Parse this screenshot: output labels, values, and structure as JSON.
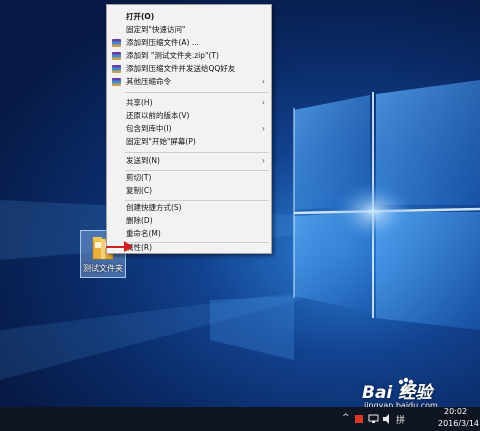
{
  "context_menu": {
    "items": [
      {
        "label": "打开(O)",
        "bold": true
      },
      {
        "label": "固定到\"快速访问\""
      },
      {
        "label": "添加到压缩文件(A) ...",
        "icon": "winrar-icon"
      },
      {
        "label": "添加到 \"测试文件夹.zip\"(T)",
        "icon": "winrar-icon"
      },
      {
        "label": "添加到压缩文件并发送给QQ好友",
        "icon": "winrar-icon"
      },
      {
        "label": "其他压缩命令",
        "icon": "winrar-icon",
        "submenu": true
      },
      {
        "label": "共享(H)",
        "submenu": true
      },
      {
        "label": "还原以前的版本(V)"
      },
      {
        "label": "包含到库中(I)",
        "submenu": true
      },
      {
        "label": "固定到\"开始\"屏幕(P)"
      },
      {
        "label": "发送到(N)",
        "submenu": true
      },
      {
        "label": "剪切(T)"
      },
      {
        "label": "复制(C)"
      },
      {
        "label": "创建快捷方式(S)"
      },
      {
        "label": "删除(D)"
      },
      {
        "label": "重命名(M)"
      },
      {
        "label": "属性(R)"
      }
    ],
    "submenu_arrow": "›"
  },
  "desktop": {
    "folder_label": "测试文件夹"
  },
  "taskbar": {
    "tray_up_arrow": "^",
    "tray_pinyin": "拼",
    "clock_time": "20:02",
    "clock_date": "2016/3/14"
  },
  "watermark": {
    "main": "Bai 经验",
    "sub": "jingyan.baidu.com"
  },
  "colors": {
    "menu_bg": "#f2f2f2",
    "annotation_red": "#d42020",
    "taskbar_bg": "#101621"
  }
}
